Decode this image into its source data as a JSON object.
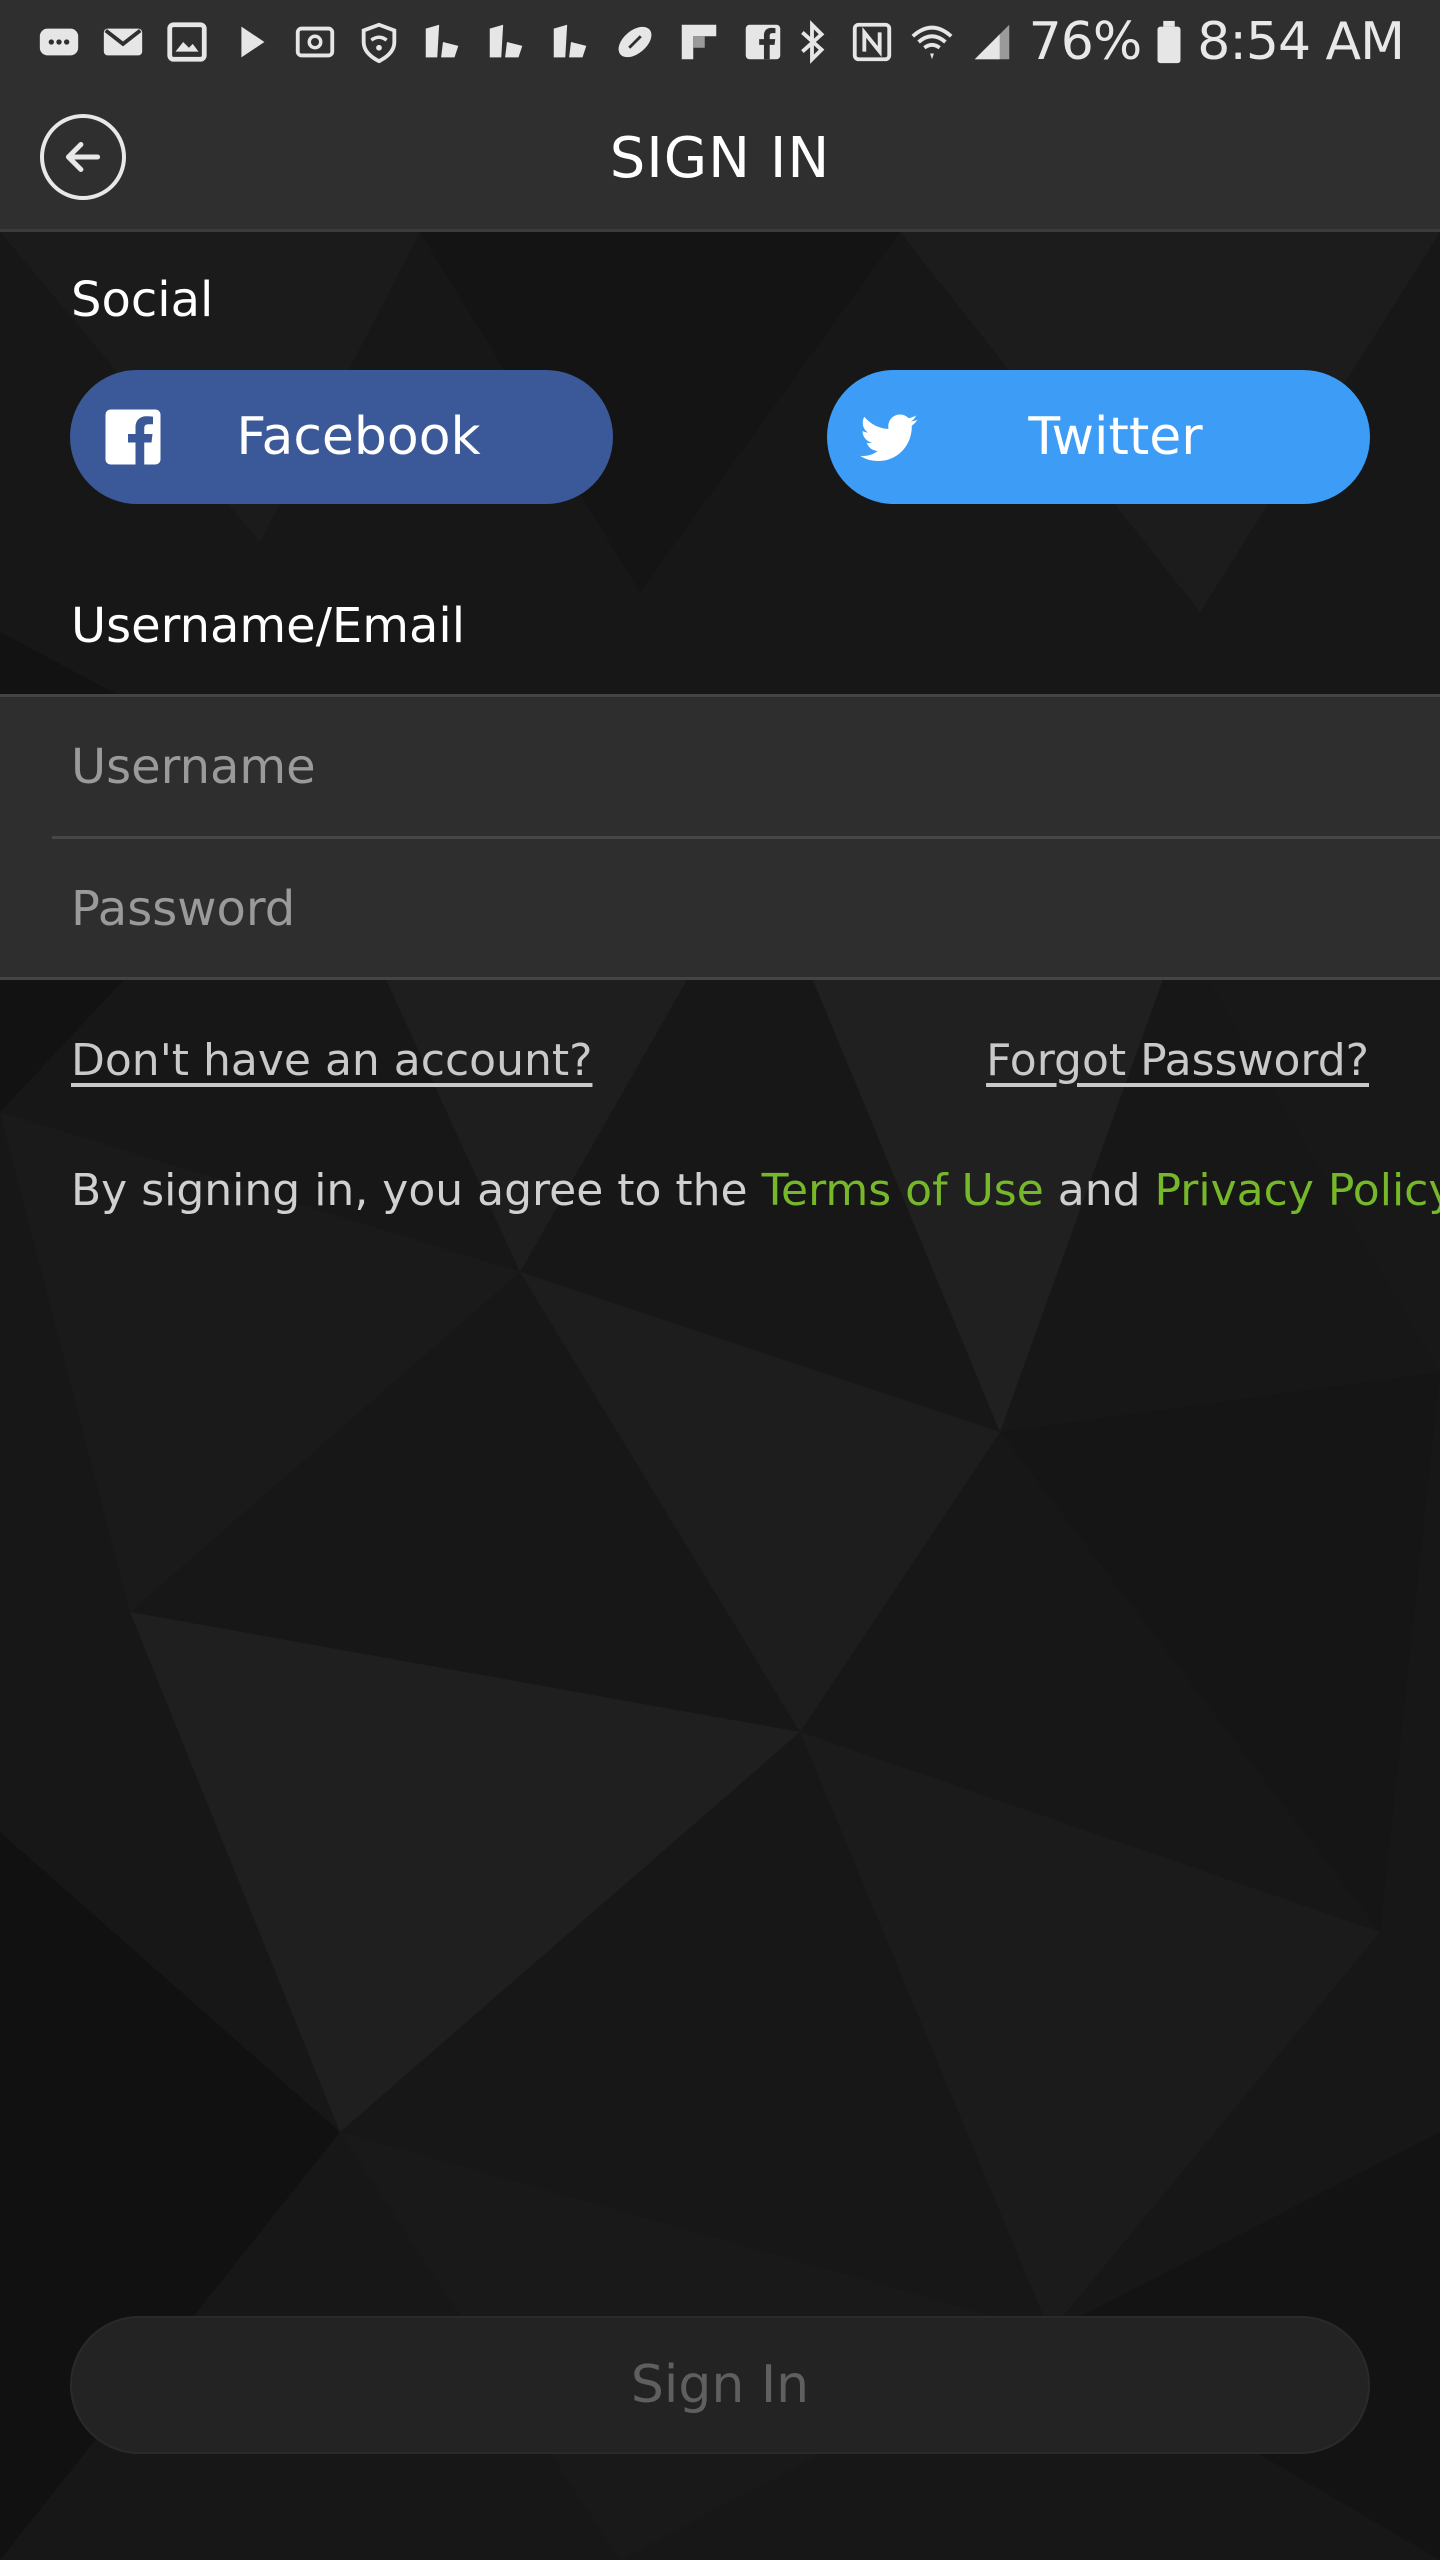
{
  "status_bar": {
    "battery": "76%",
    "time": "8:54 AM",
    "left_icons": [
      "message-icon",
      "email-icon",
      "gallery-icon",
      "play-icon",
      "cast-icon",
      "wifi-shield-icon",
      "app-icon",
      "app-icon",
      "app-icon",
      "football-icon",
      "flipboard-icon",
      "facebook-icon"
    ],
    "right_icons": [
      "bluetooth-icon",
      "nfc-icon",
      "wifi-icon",
      "signal-icon",
      "battery-icon"
    ]
  },
  "app_bar": {
    "title": "SIGN IN",
    "back_icon": "back-arrow-icon"
  },
  "social": {
    "label": "Social",
    "facebook": {
      "label": "Facebook",
      "color": "#3b5998",
      "icon": "facebook-icon"
    },
    "twitter": {
      "label": "Twitter",
      "color": "#3d9df6",
      "icon": "twitter-icon"
    }
  },
  "credentials": {
    "label": "Username/Email",
    "username": {
      "placeholder": "Username",
      "value": ""
    },
    "password": {
      "placeholder": "Password",
      "value": ""
    }
  },
  "links": {
    "no_account": "Don't have an account?",
    "forgot_password": "Forgot Password?"
  },
  "terms": {
    "prefix": "By signing in, you agree to the ",
    "terms_of_use": "Terms of Use",
    "and": " and ",
    "privacy_policy": "Privacy Policy",
    "suffix": ".",
    "link_color": "#76b82a"
  },
  "sign_in_button": {
    "label": "Sign In"
  }
}
